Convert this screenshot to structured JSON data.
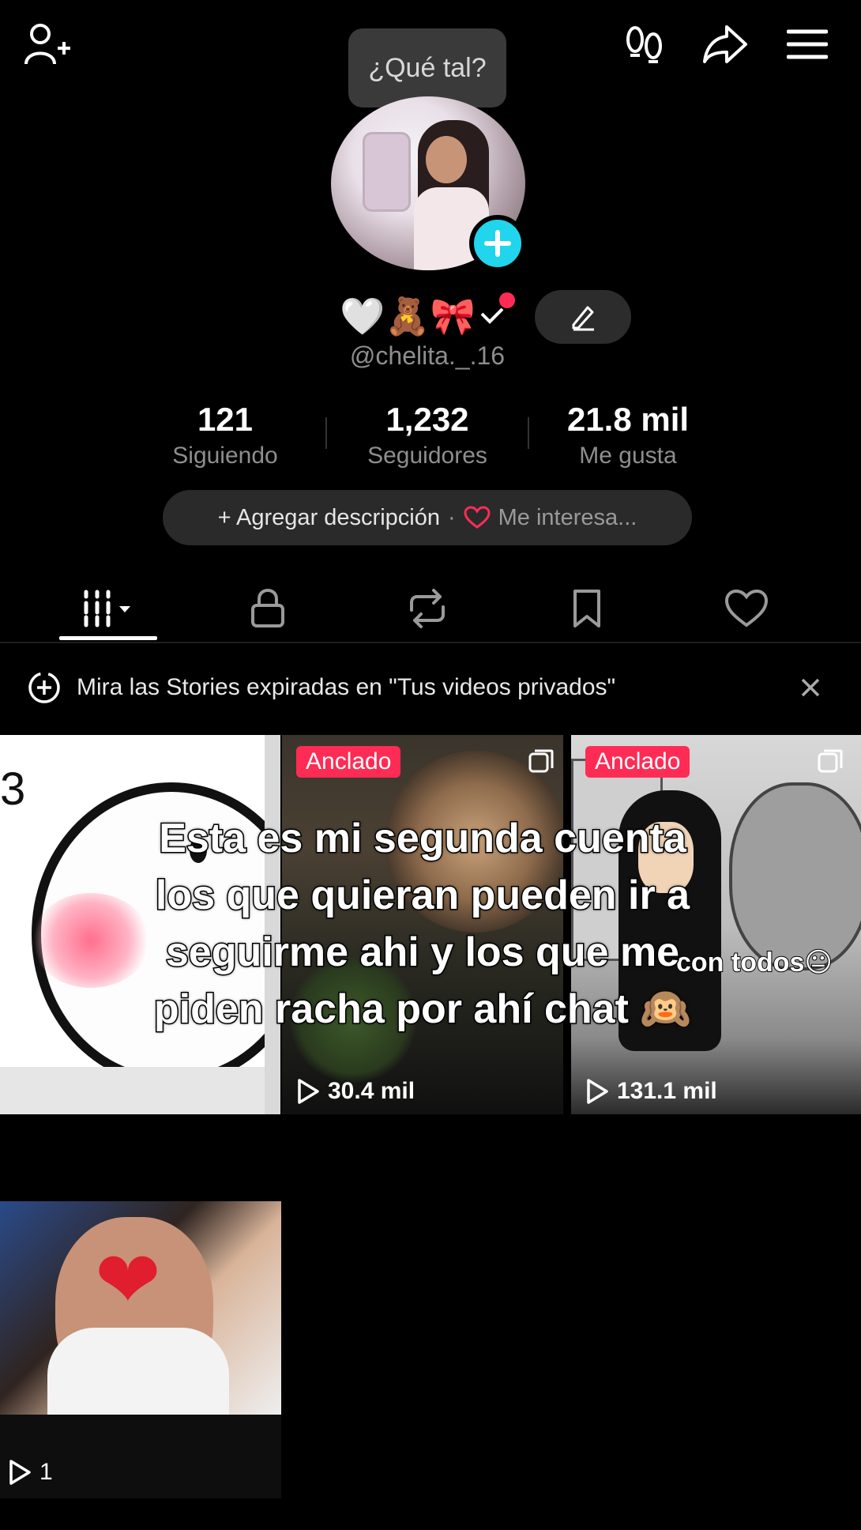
{
  "header": {
    "bubble_text": "¿Qué tal?"
  },
  "profile": {
    "name_emojis": "🤍🧸🎀",
    "username": "@chelita._.16",
    "stats": [
      {
        "value": "121",
        "label": "Siguiendo"
      },
      {
        "value": "1,232",
        "label": "Seguidores"
      },
      {
        "value": "21.8 mil",
        "label": "Me gusta"
      }
    ],
    "add_description": "+ Agregar descripción",
    "dot": "·",
    "interests": "Me interesa..."
  },
  "notice": {
    "text": "Mira las Stories expiradas en \"Tus videos privados\""
  },
  "grid": {
    "videos": [
      {
        "pinned": "",
        "views": "",
        "corner_text": "3"
      },
      {
        "pinned": "Anclado",
        "views": "30.4 mil"
      },
      {
        "pinned": "Anclado",
        "views": "131.1 mil",
        "caption": "con todos😐"
      },
      {
        "pinned": "",
        "views": "1"
      }
    ]
  },
  "overlay_text": [
    "Esta es mi segunda cuenta",
    "los que quieran pueden ir a",
    "seguirme ahi y los que me",
    "piden racha por ahí chat 🙉"
  ],
  "colors": {
    "accent_red": "#fe2c55",
    "accent_cyan": "#20d5ec"
  }
}
